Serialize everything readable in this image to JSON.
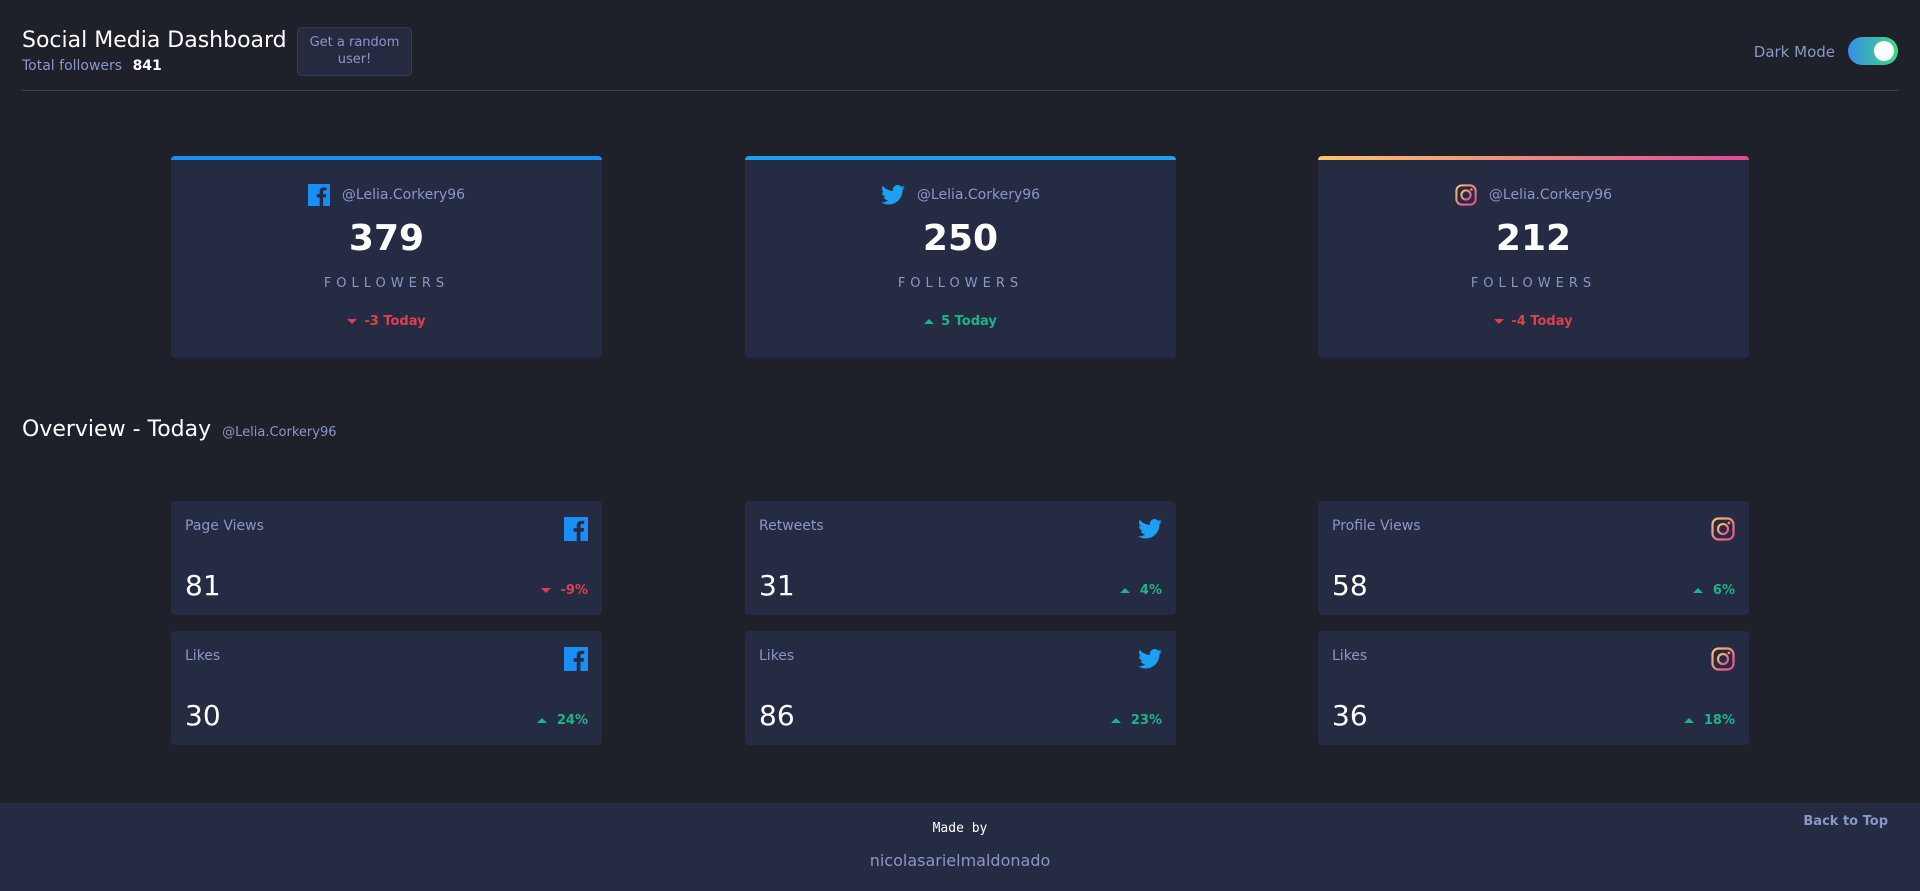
{
  "header": {
    "title": "Social Media Dashboard",
    "total_label": "Total followers",
    "total_value": "841",
    "random_button": "Get a random user!",
    "dark_mode_label": "Dark Mode",
    "dark_mode_on": true
  },
  "colors": {
    "up": "#1db489",
    "down": "#dc414c",
    "facebook": "#198ff5",
    "twitter": "#1ca0f2",
    "instagram_start": "#fdc468",
    "instagram_end": "#df4996"
  },
  "follower_cards": [
    {
      "network": "facebook",
      "icon": "facebook-icon",
      "handle": "@Lelia.Corkery96",
      "count": "379",
      "label": "FOLLOWERS",
      "change": "-3 Today",
      "direction": "down"
    },
    {
      "network": "twitter",
      "icon": "twitter-icon",
      "handle": "@Lelia.Corkery96",
      "count": "250",
      "label": "FOLLOWERS",
      "change": "5 Today",
      "direction": "up"
    },
    {
      "network": "instagram",
      "icon": "instagram-icon",
      "handle": "@Lelia.Corkery96",
      "count": "212",
      "label": "FOLLOWERS",
      "change": "-4 Today",
      "direction": "down"
    }
  ],
  "overview": {
    "title": "Overview - Today",
    "handle": "@Lelia.Corkery96",
    "cards": [
      {
        "label": "Page Views",
        "icon": "facebook-icon",
        "value": "81",
        "change": "-9%",
        "direction": "down"
      },
      {
        "label": "Retweets",
        "icon": "twitter-icon",
        "value": "31",
        "change": "4%",
        "direction": "up"
      },
      {
        "label": "Profile Views",
        "icon": "instagram-icon",
        "value": "58",
        "change": "6%",
        "direction": "up"
      },
      {
        "label": "Likes",
        "icon": "facebook-icon",
        "value": "30",
        "change": "24%",
        "direction": "up"
      },
      {
        "label": "Likes",
        "icon": "twitter-icon",
        "value": "86",
        "change": "23%",
        "direction": "up"
      },
      {
        "label": "Likes",
        "icon": "instagram-icon",
        "value": "36",
        "change": "18%",
        "direction": "up"
      }
    ]
  },
  "footer": {
    "made_by": "Made by",
    "author": "nicolasarielmaldonado",
    "back_to_top": "Back to Top"
  }
}
